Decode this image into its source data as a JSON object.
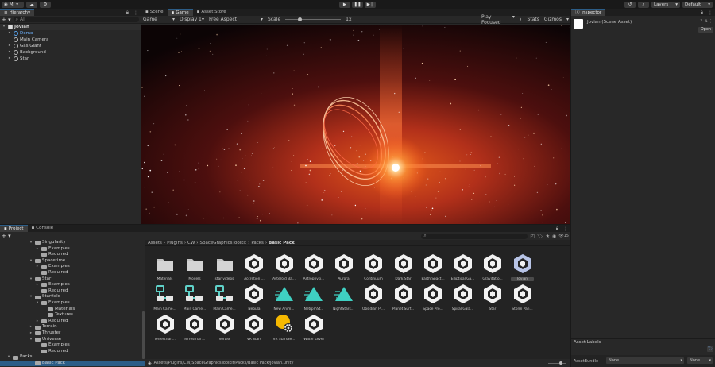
{
  "toolbar": {
    "account": "MJ",
    "layers": "Layers",
    "layout": "Default"
  },
  "hierarchy": {
    "tab": "Hierarchy",
    "search_placeholder": "All",
    "items": [
      {
        "label": "Jovian",
        "depth": 0,
        "arrow": "▾",
        "icon": "scene-icon"
      },
      {
        "label": "Demo",
        "depth": 1,
        "arrow": "▸",
        "icon": "gameobject-icon"
      },
      {
        "label": "Main Camera",
        "depth": 1,
        "arrow": "",
        "icon": "gameobject-icon"
      },
      {
        "label": "Gas Giant",
        "depth": 1,
        "arrow": "▸",
        "icon": "gameobject-icon"
      },
      {
        "label": "Background",
        "depth": 1,
        "arrow": "▸",
        "icon": "gameobject-icon"
      },
      {
        "label": "Star",
        "depth": 1,
        "arrow": "▸",
        "icon": "gameobject-icon"
      }
    ]
  },
  "scene_tabs": [
    {
      "label": "Scene",
      "active": false
    },
    {
      "label": "Game",
      "active": true
    },
    {
      "label": "Asset Store",
      "active": false
    }
  ],
  "game_toolbar": {
    "mode": "Game",
    "display": "Display 1",
    "aspect": "Free Aspect",
    "scale_label": "Scale",
    "scale_value": "1x",
    "play_mode": "Play Focused",
    "stats": "Stats",
    "gizmos": "Gizmos"
  },
  "inspector": {
    "tab": "Inspector",
    "title": "Jovian (Scene Asset)",
    "open_button": "Open",
    "asset_labels": "Asset Labels",
    "assetbundle_label": "AssetBundle",
    "assetbundle_value": "None",
    "variant_value": "None"
  },
  "project": {
    "tabs": [
      {
        "label": "Project",
        "active": true
      },
      {
        "label": "Console",
        "active": false
      }
    ],
    "badge": "15",
    "breadcrumb": [
      "Assets",
      "Plugins",
      "CW",
      "SpaceGraphicsToolkit",
      "Packs",
      "Basic Pack"
    ],
    "tree": [
      {
        "label": "Singularity",
        "depth": 1,
        "arrow": "▾"
      },
      {
        "label": "Examples",
        "depth": 2,
        "arrow": "▸"
      },
      {
        "label": "Required",
        "depth": 2,
        "arrow": ""
      },
      {
        "label": "Spacetime",
        "depth": 1,
        "arrow": "▾"
      },
      {
        "label": "Examples",
        "depth": 2,
        "arrow": "▸"
      },
      {
        "label": "Required",
        "depth": 2,
        "arrow": ""
      },
      {
        "label": "Star",
        "depth": 1,
        "arrow": "▾"
      },
      {
        "label": "Examples",
        "depth": 2,
        "arrow": "▸"
      },
      {
        "label": "Required",
        "depth": 2,
        "arrow": ""
      },
      {
        "label": "Starfield",
        "depth": 1,
        "arrow": "▾"
      },
      {
        "label": "Examples",
        "depth": 2,
        "arrow": "▾"
      },
      {
        "label": "Materials",
        "depth": 3,
        "arrow": ""
      },
      {
        "label": "Textures",
        "depth": 3,
        "arrow": ""
      },
      {
        "label": "Required",
        "depth": 2,
        "arrow": "▸"
      },
      {
        "label": "Terrain",
        "depth": 1,
        "arrow": "▸"
      },
      {
        "label": "Thruster",
        "depth": 1,
        "arrow": "▸"
      },
      {
        "label": "Universe",
        "depth": 1,
        "arrow": "▾"
      },
      {
        "label": "Examples",
        "depth": 2,
        "arrow": ""
      },
      {
        "label": "Required",
        "depth": 2,
        "arrow": ""
      },
      {
        "label": "Packs",
        "depth": 0,
        "arrow": "▾"
      },
      {
        "label": "Basic Pack",
        "depth": 1,
        "arrow": "",
        "selected": true
      }
    ],
    "assets": [
      {
        "label": "Materials",
        "kind": "folder"
      },
      {
        "label": "Models",
        "kind": "folder"
      },
      {
        "label": "star videos",
        "kind": "folder"
      },
      {
        "label": "Accretion ...",
        "kind": "unity"
      },
      {
        "label": "Asteroid Ba...",
        "kind": "unity"
      },
      {
        "label": "Astrophysi...",
        "kind": "unity"
      },
      {
        "label": "Aurora",
        "kind": "unity"
      },
      {
        "label": "Continuum",
        "kind": "unity"
      },
      {
        "label": "Dark Star",
        "kind": "unity"
      },
      {
        "label": "Earth Spact...",
        "kind": "unity"
      },
      {
        "label": "Elliptical Ga...",
        "kind": "unity"
      },
      {
        "label": "Gravitatio...",
        "kind": "unity"
      },
      {
        "label": "Jovian",
        "kind": "unity",
        "selected": true
      },
      {
        "label": "Main Came...",
        "kind": "prefab"
      },
      {
        "label": "Main Came...",
        "kind": "prefab"
      },
      {
        "label": "Main Came...",
        "kind": "prefab"
      },
      {
        "label": "Nebula",
        "kind": "unity"
      },
      {
        "label": "New Anim...",
        "kind": "anim"
      },
      {
        "label": "NetrpmSt...",
        "kind": "anim"
      },
      {
        "label": "NightStars...",
        "kind": "anim"
      },
      {
        "label": "Obsidian Pl...",
        "kind": "unity"
      },
      {
        "label": "Planet Surf...",
        "kind": "unity"
      },
      {
        "label": "Space Pro...",
        "kind": "unity"
      },
      {
        "label": "Spiral Gala...",
        "kind": "unity"
      },
      {
        "label": "Star",
        "kind": "unity"
      },
      {
        "label": "Storm Pan...",
        "kind": "unity"
      },
      {
        "label": "Terrestrial ...",
        "kind": "unity"
      },
      {
        "label": "Terrestrial ...",
        "kind": "unity"
      },
      {
        "label": "Vortex",
        "kind": "unity"
      },
      {
        "label": "VR Stars",
        "kind": "unity"
      },
      {
        "label": "VR StarsSe...",
        "kind": "settings"
      },
      {
        "label": "Water Level",
        "kind": "unity"
      }
    ],
    "footer_path": "Assets/Plugins/CW/SpaceGraphicsToolkit/Packs/Basic Pack/Jovian.unity"
  }
}
